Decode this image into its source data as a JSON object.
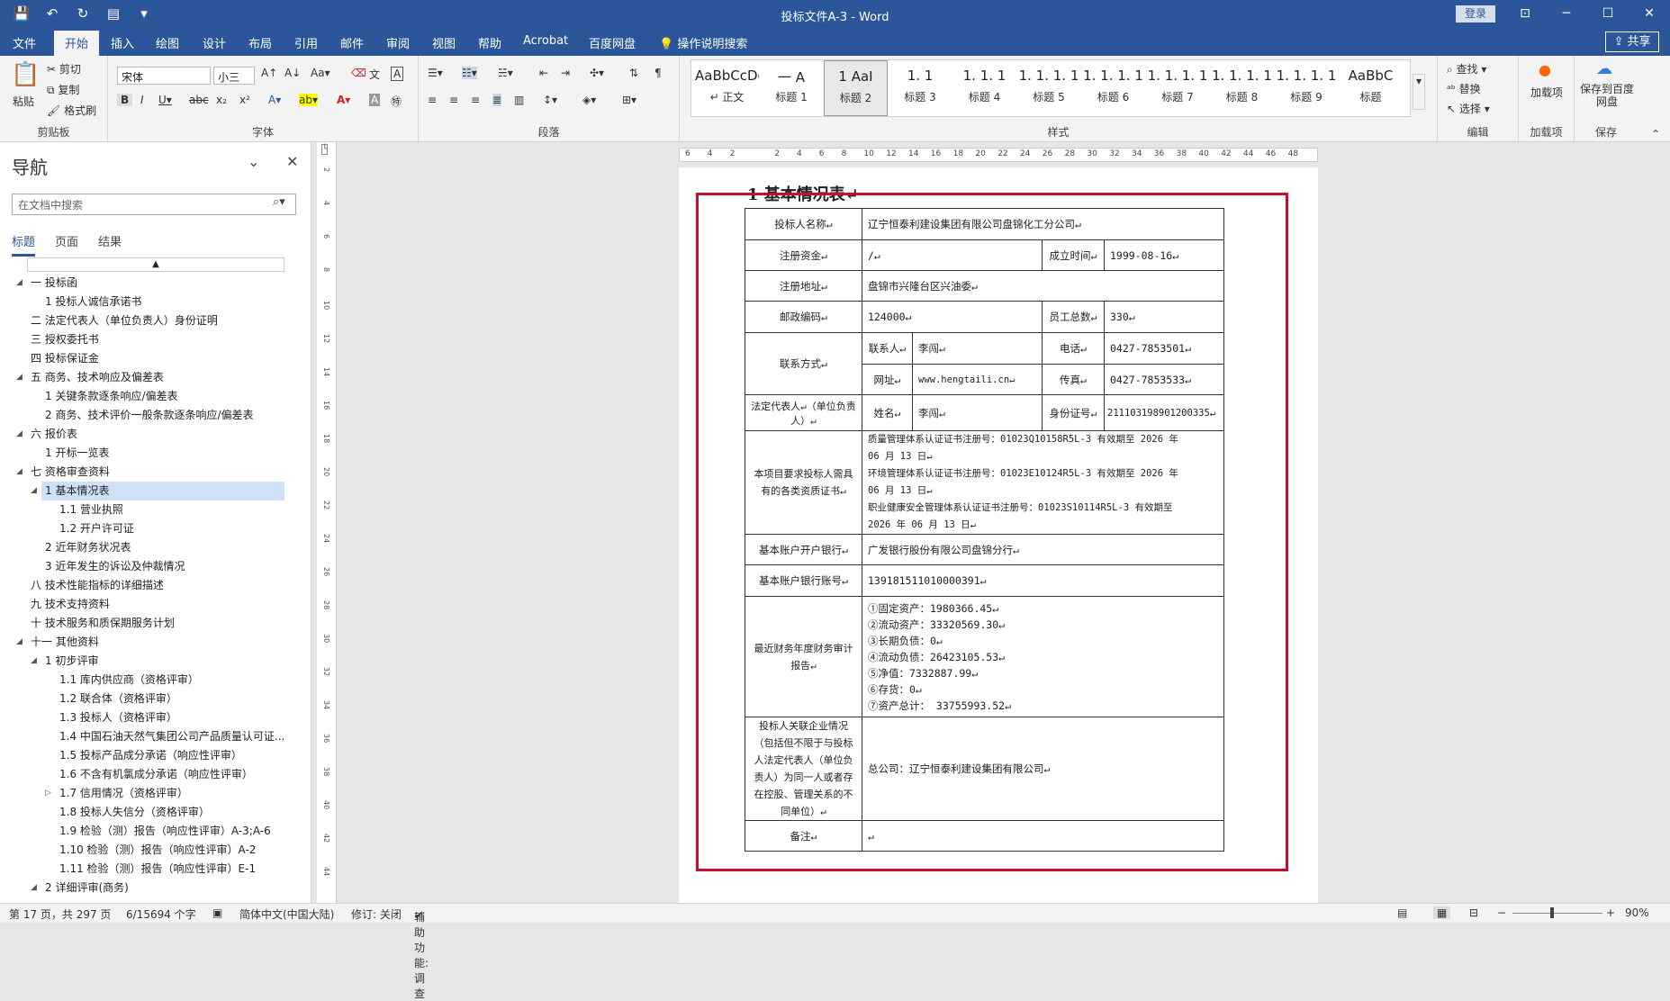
{
  "titlebar": {
    "title": "投标文件A-3 - Word",
    "login": "登录"
  },
  "tabs": [
    "文件",
    "开始",
    "插入",
    "绘图",
    "设计",
    "布局",
    "引用",
    "邮件",
    "审阅",
    "视图",
    "帮助",
    "Acrobat",
    "百度网盘"
  ],
  "tell_me": "操作说明搜索",
  "share": "共享",
  "ribbon": {
    "clipboard": {
      "paste": "粘贴",
      "cut": "剪切",
      "copy": "复制",
      "painter": "格式刷",
      "label": "剪贴板"
    },
    "font": {
      "name": "宋体",
      "size": "小三",
      "label": "字体"
    },
    "paragraph": {
      "label": "段落"
    },
    "styles": {
      "label": "样式",
      "items": [
        {
          "preview": "AaBbCcDdE",
          "name": "↵ 正文"
        },
        {
          "preview": "一  A",
          "name": "标题 1"
        },
        {
          "preview": "1  AaI",
          "name": "标题 2"
        },
        {
          "preview": "1. 1",
          "name": "标题 3"
        },
        {
          "preview": "1. 1. 1",
          "name": "标题 4"
        },
        {
          "preview": "1. 1. 1. 1",
          "name": "标题 5"
        },
        {
          "preview": "1. 1. 1. 1",
          "name": "标题 6"
        },
        {
          "preview": "1. 1. 1. 1",
          "name": "标题 7"
        },
        {
          "preview": "1. 1. 1. 1",
          "name": "标题 8"
        },
        {
          "preview": "1. 1. 1. 1",
          "name": "标题 9"
        },
        {
          "preview": "AaBbC",
          "name": "标题"
        }
      ]
    },
    "editing": {
      "find": "查找",
      "replace": "替换",
      "select": "选择",
      "label": "编辑"
    },
    "addins": {
      "btn": "加载项",
      "label": "加载项"
    },
    "save": {
      "btn": "保存到百度网盘",
      "label": "保存"
    }
  },
  "nav": {
    "title": "导航",
    "search_placeholder": "在文档中搜索",
    "tabs": [
      "标题",
      "页面",
      "结果"
    ],
    "items": [
      {
        "text": "一 投标函",
        "level": 0,
        "caret": "◢"
      },
      {
        "text": "1 投标人诚信承诺书",
        "level": 1
      },
      {
        "text": "二 法定代表人（单位负责人）身份证明",
        "level": 0
      },
      {
        "text": "三 授权委托书",
        "level": 0
      },
      {
        "text": "四 投标保证金",
        "level": 0
      },
      {
        "text": "五 商务、技术响应及偏差表",
        "level": 0,
        "caret": "◢"
      },
      {
        "text": "1 关键条款逐条响应/偏差表",
        "level": 1
      },
      {
        "text": "2 商务、技术评价一般条款逐条响应/偏差表",
        "level": 1
      },
      {
        "text": "六 报价表",
        "level": 0,
        "caret": "◢"
      },
      {
        "text": "1 开标一览表",
        "level": 1
      },
      {
        "text": "七 资格审查资料",
        "level": 0,
        "caret": "◢"
      },
      {
        "text": "1 基本情况表",
        "level": 1,
        "caret": "◢",
        "selected": true
      },
      {
        "text": "1.1 营业执照",
        "level": 2
      },
      {
        "text": "1.2 开户许可证",
        "level": 2
      },
      {
        "text": "2 近年财务状况表",
        "level": 1
      },
      {
        "text": "3 近年发生的诉讼及仲裁情况",
        "level": 1
      },
      {
        "text": "八 技术性能指标的详细描述",
        "level": 0
      },
      {
        "text": "九 技术支持资料",
        "level": 0
      },
      {
        "text": "十 技术服务和质保期服务计划",
        "level": 0
      },
      {
        "text": "十一 其他资料",
        "level": 0,
        "caret": "◢"
      },
      {
        "text": "1 初步评审",
        "level": 1,
        "caret": "◢"
      },
      {
        "text": "1.1 库内供应商（资格评审）",
        "level": 2
      },
      {
        "text": "1.2 联合体（资格评审）",
        "level": 2
      },
      {
        "text": "1.3 投标人（资格评审）",
        "level": 2
      },
      {
        "text": "1.4 中国石油天然气集团公司产品质量认可证...",
        "level": 2
      },
      {
        "text": "1.5 投标产品成分承诺（响应性评审）",
        "level": 2
      },
      {
        "text": "1.6 不含有机氯成分承诺（响应性评审）",
        "level": 2
      },
      {
        "text": "1.7 信用情况（资格评审）",
        "level": 2,
        "caret": "▷"
      },
      {
        "text": "1.8 投标人失信分（资格评审）",
        "level": 2
      },
      {
        "text": "1.9 检验（测）报告（响应性评审）A-3;A-6",
        "level": 2
      },
      {
        "text": "1.10 检验（测）报告（响应性评审）A-2",
        "level": 2
      },
      {
        "text": "1.11 检验（测）报告（响应性评审）E-1",
        "level": 2
      },
      {
        "text": "2 详细评审(商务)",
        "level": 1,
        "caret": "◢"
      }
    ]
  },
  "ruler": {
    "h": [
      "6",
      "4",
      "2",
      "",
      "2",
      "4",
      "6",
      "8",
      "10",
      "12",
      "14",
      "16",
      "18",
      "20",
      "22",
      "24",
      "26",
      "28",
      "30",
      "32",
      "34",
      "36",
      "38",
      "40",
      "42",
      "44",
      "46",
      "48"
    ],
    "v": [
      "2",
      "4",
      "6",
      "8",
      "10",
      "12",
      "14",
      "16",
      "18",
      "20",
      "22",
      "24",
      "26",
      "28",
      "30",
      "32",
      "34",
      "36",
      "38",
      "40",
      "42",
      "44"
    ]
  },
  "doc": {
    "heading": "1  基本情况表↵",
    "rows": {
      "bidder_label": "投标人名称↵",
      "bidder": "辽宁恒泰利建设集团有限公司盘锦化工分公司↵",
      "capital_label": "注册资金↵",
      "capital": "/↵",
      "est_label": "成立时间↵",
      "est": "1999-08-16↵",
      "addr_label": "注册地址↵",
      "addr": "盘锦市兴隆台区兴油委↵",
      "zip_label": "邮政编码↵",
      "zip": "124000↵",
      "staff_label": "员工总数↵",
      "staff": "330↵",
      "contact_label": "联系方式↵",
      "person_label": "联系人↵",
      "person": "李闯↵",
      "tel_label": "电话↵",
      "tel": "0427-7853501↵",
      "web_label": "网址↵",
      "web": "www.hengtaili.cn↵",
      "fax_label": "传真↵",
      "fax": "0427-7853533↵",
      "legal_label": "法定代表人↵（单位负责人）↵",
      "name_label": "姓名↵",
      "name": "李闯↵",
      "id_label": "身份证号↵",
      "id": "211103198901200335↵",
      "qual_label": "本项目要求投标人需具有的各类资质证书↵",
      "qual": [
        "质量管理体系认证证书注册号：01023Q10158R5L-3 有效期至 2026 年",
        "06 月 13 日↵",
        "环境管理体系认证证书注册号：01023E10124R5L-3 有效期至 2026 年",
        "06 月 13 日↵",
        "职业健康安全管理体系认证证书注册号：01023S10114R5L-3 有效期至",
        "2026 年 06 月 13 日↵"
      ],
      "bank_label": "基本账户开户银行↵",
      "bank": "广发银行股份有限公司盘锦分行↵",
      "acct_label": "基本账户银行账号↵",
      "acct": "139181511010000391↵",
      "fin_label": "最近财务年度财务审计报告↵",
      "fin": [
        "①固定资产：1980366.45↵",
        "②流动资产：33320569.30↵",
        "③长期负债：0↵",
        "④流动负债：26423105.53↵",
        "⑤净值：7332887.99↵",
        "⑥存货：0↵",
        "⑦资产总计： 33755993.52↵"
      ],
      "rel_label": "投标人关联企业情况（包括但不限于与投标人法定代表人（单位负责人）为同一人或者存在控股、管理关系的不同单位）↵",
      "rel": "总公司：辽宁恒泰利建设集团有限公司↵",
      "note_label": "备注↵",
      "note": "↵"
    }
  },
  "status": {
    "page": "第 17 页，共 297 页",
    "words": "6/15694 个字",
    "lang": "简体中文(中国大陆)",
    "track": "修订: 关闭",
    "access": "辅助功能: 调查",
    "zoom": "90%"
  }
}
